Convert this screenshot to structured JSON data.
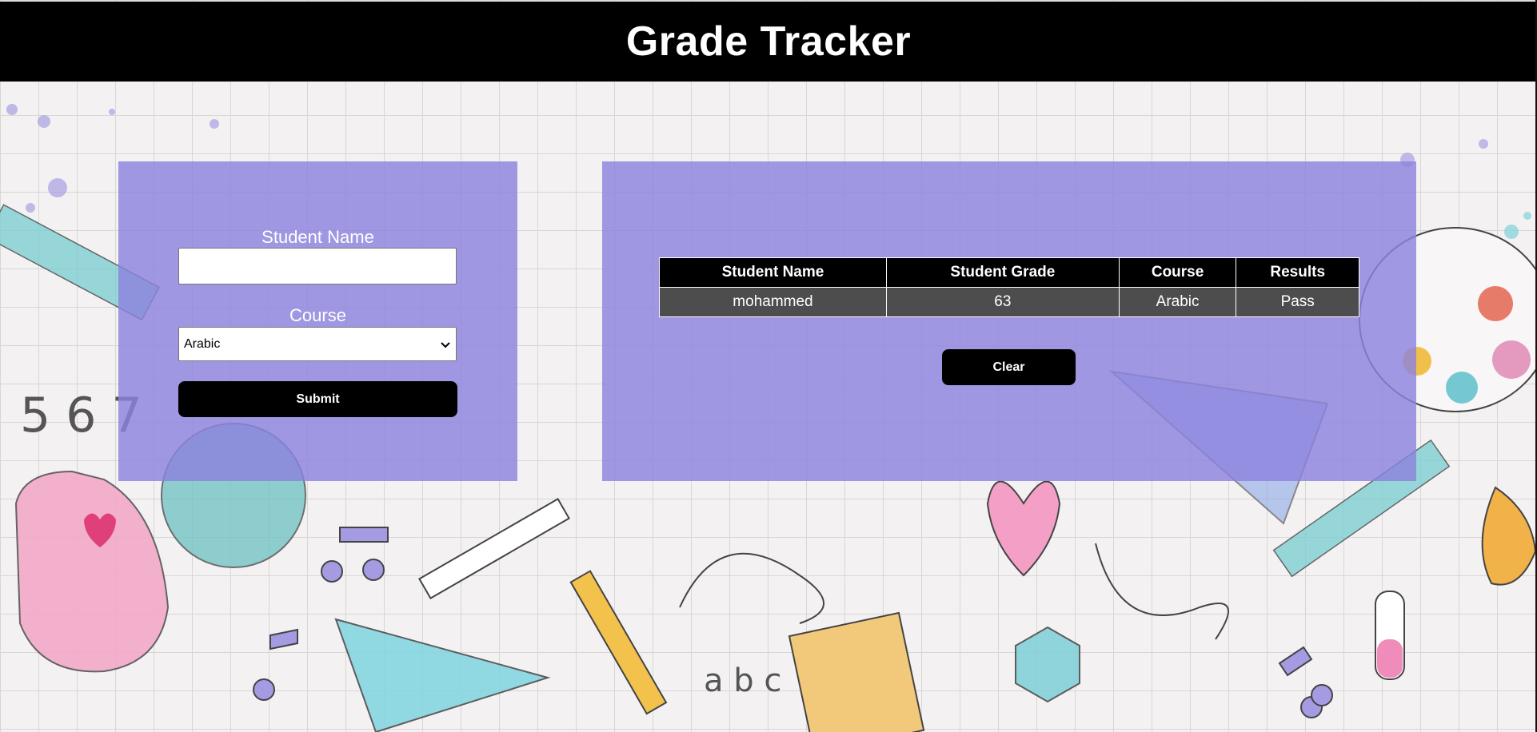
{
  "app": {
    "title": "Grade Tracker"
  },
  "form": {
    "name_label": "Student Name",
    "name_value": "",
    "course_label": "Course",
    "course_selected": "Arabic",
    "submit_label": "Submit"
  },
  "results": {
    "headers": [
      "Student Name",
      "Student Grade",
      "Course",
      "Results"
    ],
    "rows": [
      {
        "name": "mohammed",
        "grade": "63",
        "course": "Arabic",
        "result": "Pass"
      }
    ],
    "clear_label": "Clear"
  },
  "background": {
    "doodle_texts": [
      "5 6 7",
      "a b c"
    ]
  },
  "colors": {
    "panel": "#8c82de",
    "header_bg": "#000000",
    "row_bg": "#4d4d4d"
  }
}
